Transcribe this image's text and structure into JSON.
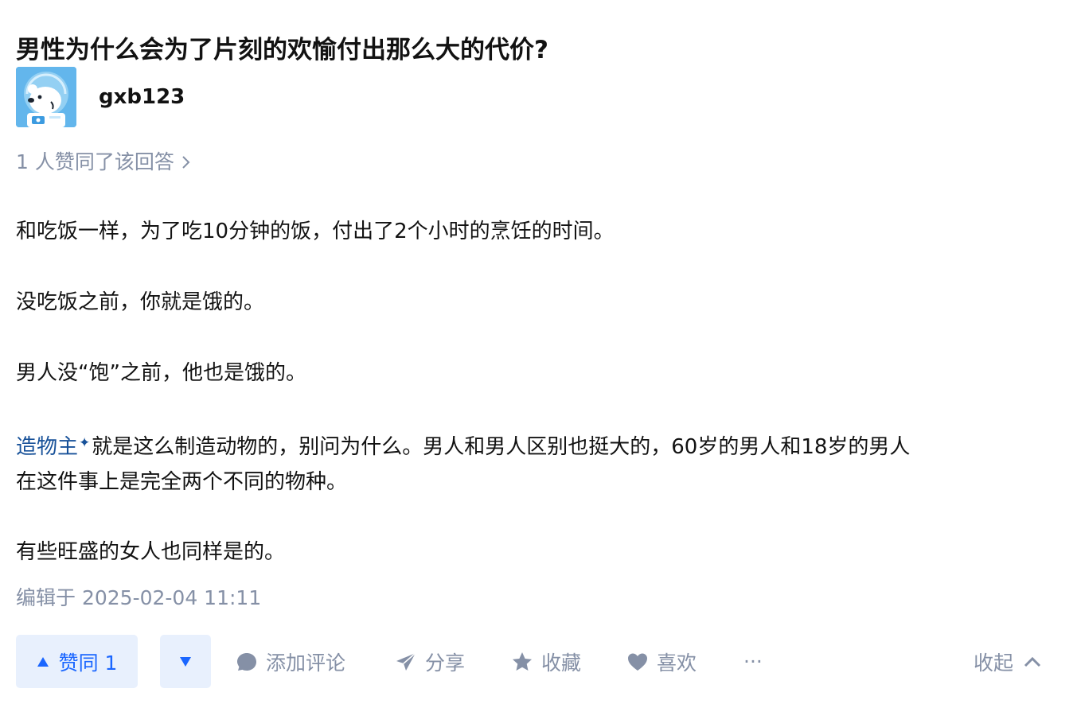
{
  "question": {
    "title": "男性为什么会为了片刻的欢愉付出那么大的代价?"
  },
  "author": {
    "name": "gxb123",
    "avatar_icon": "polar-bear-astronaut-avatar"
  },
  "voters_summary": "1 人赞同了该回答",
  "content": {
    "p1": "和吃饭一样，为了吃10分钟的饭，付出了2个小时的烹饪的时间。",
    "p2": "没吃饭之前，你就是饿的。",
    "p3": "男人没“饱”之前，他也是饿的。",
    "p4_link": "造物主",
    "p4_link_icon": "sparkle-icon",
    "p4_line1_rest": "就是这么制造动物的，别问为什么。男人和男人区别也挺大的，60岁的男人和18岁的男人",
    "p4_line2": "在这件事上是完全两个不同的物种。",
    "p5": "有些旺盛的女人也同样是的。"
  },
  "edit_time": "编辑于 2025-02-04 11:11",
  "actions": {
    "vote_up_label": "赞同 1",
    "comment_label": "添加评论",
    "share_label": "分享",
    "favorite_label": "收藏",
    "like_label": "喜欢",
    "more_label": "···",
    "collapse_label": "收起"
  },
  "colors": {
    "text": "#121212",
    "meta": "#8590a6",
    "link": "#175199",
    "brand": "#1a66ff",
    "vote_bg": "#e8f0fd"
  }
}
